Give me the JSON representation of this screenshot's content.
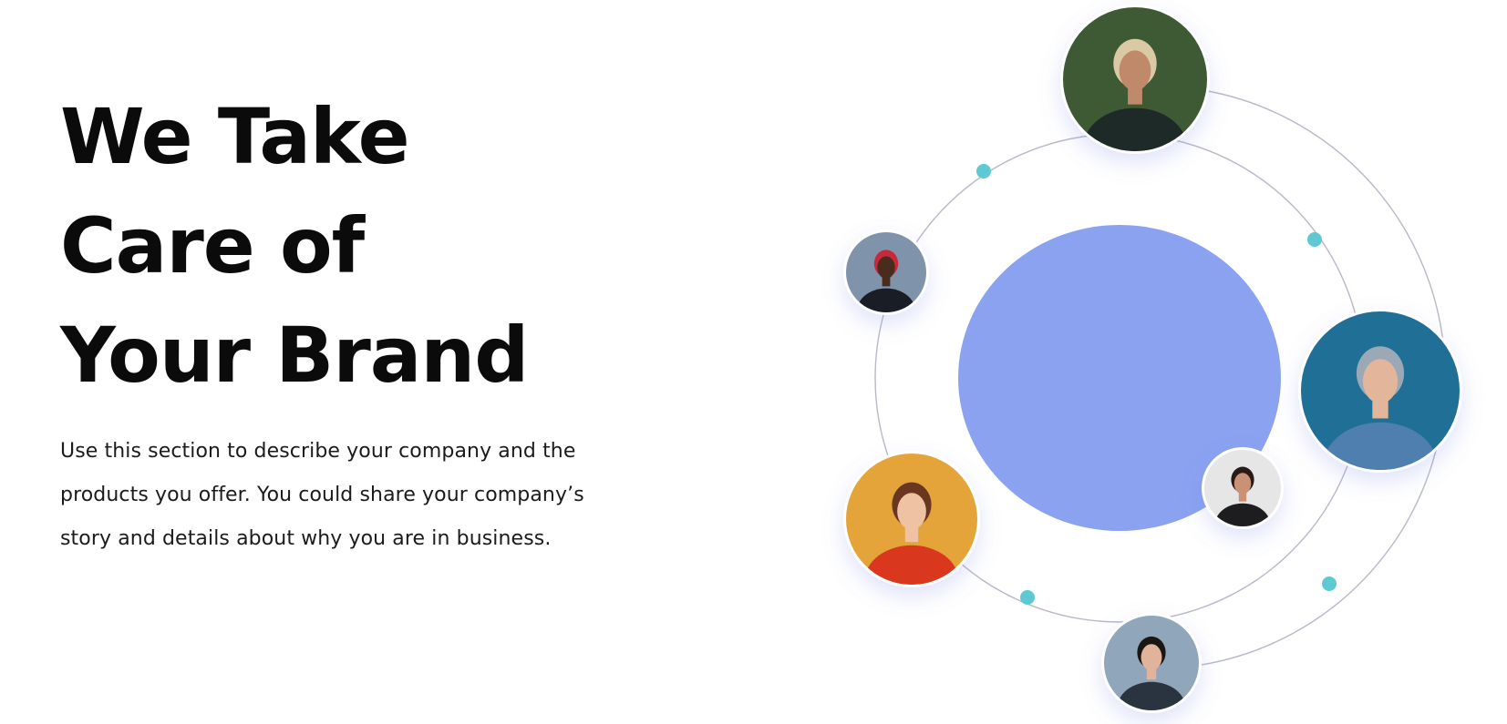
{
  "hero": {
    "headline_lines": [
      "We Take",
      "Care of",
      "Your Brand"
    ],
    "description_lines": [
      "Use this section to describe your company and the",
      "products you offer. You could share your company’s",
      "story and details about why you are in business."
    ]
  },
  "illustration": {
    "center_color": "#8aa2f0",
    "orbit_line_color": "#b7b9c9",
    "dot_color": "#5ec9d3",
    "avatars": [
      {
        "name": "woman-top-avatar",
        "bg": "#3e5a34",
        "skin": "#c08a6a",
        "hair": "#d9c9a5",
        "cloth": "#1d2a28"
      },
      {
        "name": "man-cap-avatar",
        "bg": "#7f93aa",
        "skin": "#4a2c1e",
        "hair": "#c9283a",
        "cloth": "#1a1d26"
      },
      {
        "name": "woman-hoodie-avatar",
        "bg": "#1f6f96",
        "skin": "#e2b69a",
        "hair": "#9aa9b5",
        "cloth": "#4f7fae"
      },
      {
        "name": "woman-smile-avatar",
        "bg": "#e6e6e6",
        "skin": "#c99277",
        "hair": "#2a1a16",
        "cloth": "#1d1d1f"
      },
      {
        "name": "woman-red-avatar",
        "bg": "#e4a43a",
        "skin": "#f0c2a4",
        "hair": "#6a3620",
        "cloth": "#d9381e"
      },
      {
        "name": "man-suit-avatar",
        "bg": "#8fa6bb",
        "skin": "#e0b39a",
        "hair": "#1c1613",
        "cloth": "#2a3340"
      }
    ]
  }
}
